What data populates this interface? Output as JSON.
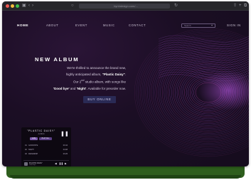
{
  "browser": {
    "url": "bynhdesign.com/..."
  },
  "nav": {
    "items": [
      "HOME",
      "ABOUT",
      "EVENT",
      "MUSIC",
      "CONTACT"
    ],
    "search_placeholder": "Search",
    "search_icon": "plus-icon",
    "sign_in": "SIGN IN"
  },
  "hero": {
    "title": "NEW ALBUM",
    "line1": "We're thrilled to announce the brand new,",
    "line2_pre": "highly anticipated album, ",
    "line2_album": "\"Plastic Daisy\"",
    "line2_post": ".",
    "line3_pre": "Our 2",
    "line3_sup": "nd",
    "line3_post": " studio album, with songs like",
    "line4_song1": "'Good bye'",
    "line4_mid": " and ",
    "line4_song2": "'Night'",
    "line4_post": ". Available for preorder now.",
    "cta": "BUY ONLINE"
  },
  "player": {
    "album": "\"PLASTIC DAISY\"",
    "artist": "ALBUM",
    "pill_left": "LIVE",
    "pill_right": "PLAY ALL",
    "tracks": [
      {
        "num": "01",
        "name": "GOOD BYE",
        "length": "03:44"
      },
      {
        "num": "02",
        "name": "NIGHT",
        "length": "04:08"
      },
      {
        "num": "03",
        "name": "RAINDROP",
        "length": "03:25"
      }
    ],
    "now_playing_title": "PLASTIC DAISY",
    "now_playing_sub": "Good bye"
  },
  "colors": {
    "accent": "#7b5aa8",
    "wave_purple": "#b45ce6",
    "wave_magenta": "#d84ec8",
    "button_bg": "#2a2a55",
    "base_green": "#2e5e1d"
  }
}
